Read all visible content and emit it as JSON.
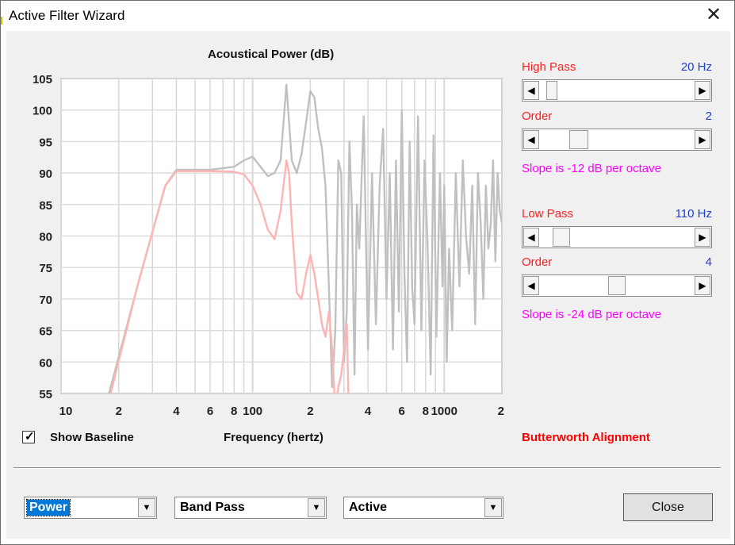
{
  "window": {
    "title": "Active Filter Wizard",
    "close_glyph": "✕"
  },
  "chart_data": {
    "type": "line",
    "title": "Acoustical Power (dB)",
    "xlabel": "Frequency (hertz)",
    "ylabel": "",
    "x_scale": "log",
    "xlim": [
      10,
      2000
    ],
    "ylim": [
      55,
      105
    ],
    "yticks": [
      "105",
      "100",
      "95",
      "90",
      "85",
      "80",
      "75",
      "70",
      "65",
      "60",
      "55"
    ],
    "xticks": [
      "10",
      "2",
      "4",
      "6",
      "8",
      "100",
      "2",
      "4",
      "6",
      "8",
      "1000",
      "2"
    ],
    "grid": true,
    "series": [
      {
        "color": "#c0c0c0",
        "x": [
          10,
          17.8,
          25,
          35,
          40,
          45,
          60,
          80,
          90,
          100,
          110,
          120,
          130,
          140,
          150,
          160,
          170,
          180,
          190,
          200,
          210,
          220,
          230,
          240,
          250,
          260,
          270,
          280,
          290,
          300,
          310,
          320,
          330,
          340,
          350,
          360,
          380,
          400,
          420,
          440,
          460,
          480,
          500,
          520,
          540,
          560,
          580,
          600,
          620,
          640,
          660,
          680,
          700,
          730,
          760,
          790,
          820,
          850,
          880,
          910,
          950,
          980,
          1000,
          1030,
          1060,
          1100,
          1150,
          1200,
          1250,
          1300,
          1350,
          1400,
          1450,
          1500,
          1550,
          1600,
          1650,
          1700,
          1750,
          1800,
          1850,
          1900,
          1950,
          2000
        ],
        "y": [
          38,
          55,
          72,
          88,
          90.5,
          90.5,
          90.5,
          91,
          92,
          92.6,
          91,
          89.5,
          90,
          92,
          104,
          92,
          90,
          93,
          98,
          103,
          102,
          97,
          94,
          88,
          72,
          56,
          65,
          92,
          90,
          60,
          68,
          95,
          84,
          58,
          85,
          78,
          99,
          62,
          90,
          66,
          88,
          97,
          70,
          90,
          62,
          92,
          68,
          100,
          74,
          60,
          95,
          72,
          66,
          99,
          65,
          92,
          78,
          58,
          96,
          64,
          90,
          72,
          88,
          60,
          78,
          65,
          90,
          72,
          92,
          80,
          74,
          88,
          66,
          90,
          82,
          70,
          88,
          78,
          82,
          92,
          76,
          90,
          84,
          82
        ]
      },
      {
        "color": "#ffb4b4",
        "x": [
          10,
          17.8,
          25,
          35,
          40,
          45,
          60,
          80,
          90,
          100,
          110,
          120,
          130,
          140,
          150,
          155,
          160,
          170,
          180,
          190,
          200,
          210,
          220,
          230,
          240,
          250,
          260,
          270,
          280,
          290,
          300,
          310,
          320
        ],
        "y": [
          36,
          54,
          72,
          88,
          90.3,
          90.3,
          90.3,
          90.2,
          89.8,
          88,
          85,
          81,
          79.5,
          84,
          92,
          90,
          82,
          71,
          70,
          74,
          77,
          74,
          70,
          66,
          64,
          68,
          62,
          52,
          56,
          58,
          62,
          66,
          48
        ]
      }
    ]
  },
  "controls": {
    "show_baseline_label": "Show Baseline",
    "show_baseline_checked": true,
    "check_glyph": "✓",
    "alignment_label": "Butterworth Alignment",
    "high_pass": {
      "label": "High Pass",
      "value_text": "20 Hz",
      "slider_pos": 0.05,
      "order_label": "Order",
      "order_value": "2",
      "order_pos": 0.22,
      "slope_text": "Slope is -12 dB per octave"
    },
    "low_pass": {
      "label": "Low Pass",
      "value_text": "110 Hz",
      "slider_pos": 0.1,
      "order_label": "Order",
      "order_value": "4",
      "order_pos": 0.5,
      "slope_text": "Slope is -24 dB per octave"
    },
    "arrow_left": "◀",
    "arrow_right": "▶",
    "arrow_down": "▼"
  },
  "combos": {
    "measure": {
      "value": "Power"
    },
    "filter_type": {
      "value": "Band Pass"
    },
    "mode": {
      "value": "Active"
    }
  },
  "close_button_label": "Close"
}
